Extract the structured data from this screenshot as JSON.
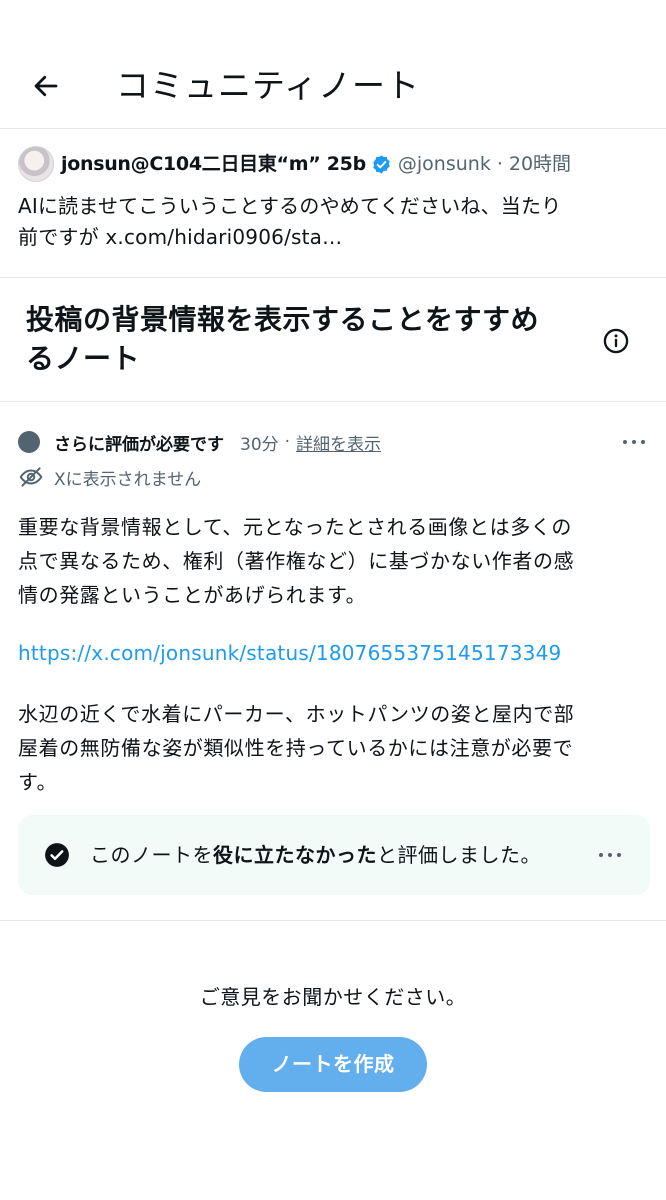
{
  "header": {
    "title": "コミュニティノート"
  },
  "post": {
    "display_name": "jonsun@C104二日目東“m” 25b",
    "handle": "@jonsunk",
    "separator": "·",
    "time": "20時間",
    "text_line1": "AIに読ませてこういうことするのやめてくださいね、当たり",
    "text_line2": "前ですが x.com/hidari0906/sta…"
  },
  "section": {
    "title_line1": "投稿の背景情報を表示することをすすめ",
    "title_line2": "るノート"
  },
  "note": {
    "status": "さらに評価が必要です",
    "time": "30分",
    "separator": "·",
    "details_link": "詳細を表示",
    "visibility": "Xに表示されません",
    "paragraph1": [
      "重要な背景情報として、元となったとされる画像とは多くの",
      "点で異なるため、権利（著作権など）に基づかない作者の感",
      "情の発露ということがあげられます。"
    ],
    "link": "https://x.com/jonsunk/status/1807655375145173349",
    "paragraph2": [
      "水辺の近くで水着にパーカー、ホットパンツの姿と屋内で部",
      "屋着の無防備な姿が類似性を持っているかには注意が必要で",
      "す。"
    ]
  },
  "rating": {
    "prefix": "このノートを",
    "emphasis": "役に立たなかった",
    "suffix": "と評価しました。"
  },
  "feedback": {
    "prompt": "ご意見をお聞かせください。",
    "create_button": "ノートを作成"
  },
  "colors": {
    "text": "#0f1419",
    "secondary": "#536471",
    "link": "#1d9bf0",
    "verified": "#1d9bf0",
    "button": "#63aeed",
    "rating_bg": "#f2fbf8"
  },
  "icons": {
    "back": "arrow-left-icon",
    "verified": "verified-badge-icon",
    "info": "info-icon",
    "status": "status-dot-icon",
    "visibility": "eye-off-icon",
    "rated": "check-circle-icon",
    "more": "more-horizontal-icon"
  }
}
